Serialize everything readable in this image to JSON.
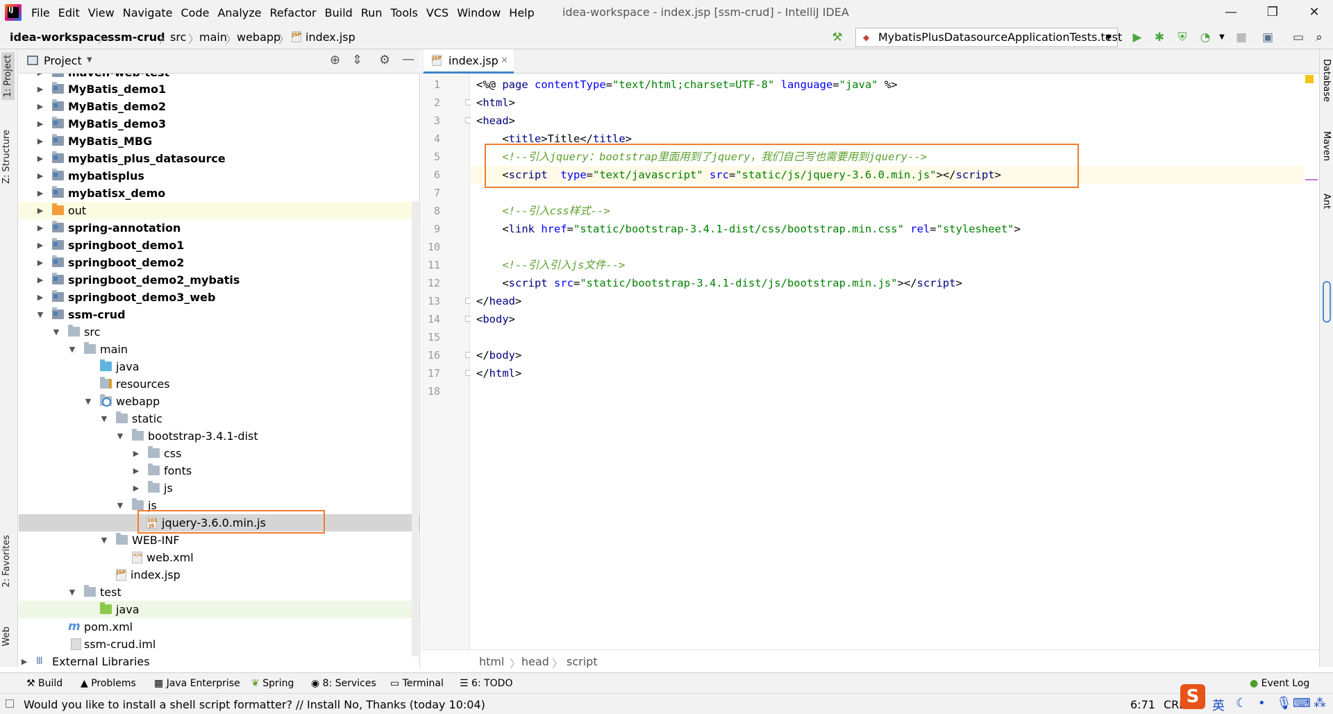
{
  "menu": {
    "items": [
      "File",
      "Edit",
      "View",
      "Navigate",
      "Code",
      "Analyze",
      "Refactor",
      "Build",
      "Run",
      "Tools",
      "VCS",
      "Window",
      "Help"
    ],
    "window_title": "idea-workspace - index.jsp [ssm-crud] - IntelliJ IDEA"
  },
  "nav": {
    "crumbs": [
      "idea-workspace",
      "ssm-crud",
      "src",
      "main",
      "webapp",
      "index.jsp"
    ],
    "run_config": "MybatisPlusDatasourceApplicationTests.test"
  },
  "left_stripe": {
    "tab1": "1: Project",
    "tab2": "Z: Structure",
    "tab3": "2: Favorites",
    "tab4": "Web"
  },
  "right_stripe": {
    "tab1": "Database",
    "tab2": "Maven",
    "tab3": "Ant"
  },
  "project": {
    "title": "Project",
    "tree": [
      {
        "label": "maven-web-test",
        "bold": true
      },
      {
        "label": "MyBatis_demo1",
        "bold": true
      },
      {
        "label": "MyBatis_demo2",
        "bold": true
      },
      {
        "label": "MyBatis_demo3",
        "bold": true
      },
      {
        "label": "MyBatis_MBG",
        "bold": true
      },
      {
        "label": "mybatis_plus_datasource",
        "bold": true
      },
      {
        "label": "mybatisplus",
        "bold": true
      },
      {
        "label": "mybatisx_demo",
        "bold": true
      },
      {
        "label": "out",
        "bold": false
      },
      {
        "label": "spring-annotation",
        "bold": true
      },
      {
        "label": "springboot_demo1",
        "bold": true
      },
      {
        "label": "springboot_demo2",
        "bold": true
      },
      {
        "label": "springboot_demo2_mybatis",
        "bold": true
      },
      {
        "label": "springboot_demo3_web",
        "bold": true
      },
      {
        "label": "ssm-crud",
        "bold": true
      },
      {
        "label": "src"
      },
      {
        "label": "main"
      },
      {
        "label": "java"
      },
      {
        "label": "resources"
      },
      {
        "label": "webapp"
      },
      {
        "label": "static"
      },
      {
        "label": "bootstrap-3.4.1-dist"
      },
      {
        "label": "css"
      },
      {
        "label": "fonts"
      },
      {
        "label": "js"
      },
      {
        "label": "js"
      },
      {
        "label": "jquery-3.6.0.min.js"
      },
      {
        "label": "WEB-INF"
      },
      {
        "label": "web.xml"
      },
      {
        "label": "index.jsp"
      },
      {
        "label": "test"
      },
      {
        "label": "java"
      },
      {
        "label": "pom.xml"
      },
      {
        "label": "ssm-crud.iml"
      },
      {
        "label": "External Libraries"
      }
    ]
  },
  "editor": {
    "tab": "index.jsp",
    "line_numbers": [
      "1",
      "2",
      "3",
      "4",
      "5",
      "6",
      "7",
      "8",
      "9",
      "10",
      "11",
      "12",
      "13",
      "14",
      "15",
      "16",
      "17",
      "18"
    ],
    "lines": [
      [
        [
          "t-dir",
          "<%@ "
        ],
        [
          "t-tag",
          "page "
        ],
        [
          "t-attr",
          "contentType"
        ],
        [
          "t-dir",
          "="
        ],
        [
          "t-str",
          "\"text/html;charset=UTF-8\""
        ],
        [
          "t-dir",
          " "
        ],
        [
          "t-attr",
          "language"
        ],
        [
          "t-dir",
          "="
        ],
        [
          "t-str",
          "\"java\""
        ],
        [
          "t-dir",
          " %>"
        ]
      ],
      [
        [
          "t-dir",
          "<"
        ],
        [
          "t-tag",
          "html"
        ],
        [
          "t-dir",
          ">"
        ]
      ],
      [
        [
          "t-dir",
          "<"
        ],
        [
          "t-tag",
          "head"
        ],
        [
          "t-dir",
          ">"
        ]
      ],
      [
        [
          "t-dir",
          "    <"
        ],
        [
          "t-tag",
          "title"
        ],
        [
          "t-dir",
          ">Title</"
        ],
        [
          "t-tag",
          "title"
        ],
        [
          "t-dir",
          ">"
        ]
      ],
      [
        [
          "t-cmt2",
          "    <!--引入jquery：bootstrap里面用到了jquery，我们自己写也需要用到jquery-->"
        ]
      ],
      [
        [
          "t-dir",
          "    <"
        ],
        [
          "t-tag",
          "script"
        ],
        [
          "t-dir",
          "  "
        ],
        [
          "t-attr",
          "type"
        ],
        [
          "t-dir",
          "="
        ],
        [
          "t-str",
          "\"text/javascript\""
        ],
        [
          "t-dir",
          " "
        ],
        [
          "t-attr",
          "src"
        ],
        [
          "t-dir",
          "="
        ],
        [
          "t-str",
          "\"static/js/jquery-3.6.0.min.js\""
        ],
        [
          "t-dir",
          "></"
        ],
        [
          "t-tag",
          "script"
        ],
        [
          "t-dir",
          ">"
        ]
      ],
      [],
      [
        [
          "t-cmt2",
          "    <!--引入css样式-->"
        ]
      ],
      [
        [
          "t-dir",
          "    <"
        ],
        [
          "t-tag",
          "link "
        ],
        [
          "t-attr",
          "href"
        ],
        [
          "t-dir",
          "="
        ],
        [
          "t-str",
          "\"static/bootstrap-3.4.1-dist/css/bootstrap.min.css\""
        ],
        [
          "t-dir",
          " "
        ],
        [
          "t-attr",
          "rel"
        ],
        [
          "t-dir",
          "="
        ],
        [
          "t-str",
          "\"stylesheet\""
        ],
        [
          "t-dir",
          ">"
        ]
      ],
      [],
      [
        [
          "t-cmt2",
          "    <!--引入引入js文件-->"
        ]
      ],
      [
        [
          "t-dir",
          "    <"
        ],
        [
          "t-tag",
          "script "
        ],
        [
          "t-attr",
          "src"
        ],
        [
          "t-dir",
          "="
        ],
        [
          "t-str",
          "\"static/bootstrap-3.4.1-dist/js/bootstrap.min.js\""
        ],
        [
          "t-dir",
          "></"
        ],
        [
          "t-tag",
          "script"
        ],
        [
          "t-dir",
          ">"
        ]
      ],
      [
        [
          "t-dir",
          "</"
        ],
        [
          "t-tag",
          "head"
        ],
        [
          "t-dir",
          ">"
        ]
      ],
      [
        [
          "t-dir",
          "<"
        ],
        [
          "t-tag",
          "body"
        ],
        [
          "t-dir",
          ">"
        ]
      ],
      [],
      [
        [
          "t-dir",
          "</"
        ],
        [
          "t-tag",
          "body"
        ],
        [
          "t-dir",
          ">"
        ]
      ],
      [
        [
          "t-dir",
          "</"
        ],
        [
          "t-tag",
          "html"
        ],
        [
          "t-dir",
          ">"
        ]
      ],
      []
    ],
    "breadcrumb": [
      "html",
      "head",
      "script"
    ]
  },
  "toolwindows": [
    {
      "label": "Build",
      "icon": "hammer-icon"
    },
    {
      "label": "Problems",
      "icon": "warning-icon"
    },
    {
      "label": "Java Enterprise",
      "icon": "java-enterprise-icon"
    },
    {
      "label": "Spring",
      "icon": "spring-leaf-icon"
    },
    {
      "label": "8: Services",
      "icon": "services-icon"
    },
    {
      "label": "Terminal",
      "icon": "terminal-icon"
    },
    {
      "label": "6: TODO",
      "icon": "todo-icon"
    },
    {
      "label": "Event Log",
      "icon": "event-log-icon"
    }
  ],
  "status": {
    "message": "Would you like to install a shell script formatter? // Install   No, Thanks (today 10:04)",
    "position": "6:71",
    "line_sep": "CRLF",
    "ime": "英"
  },
  "colors": {
    "accent": "#4083c9",
    "highlight_box": "#f07c2a"
  }
}
